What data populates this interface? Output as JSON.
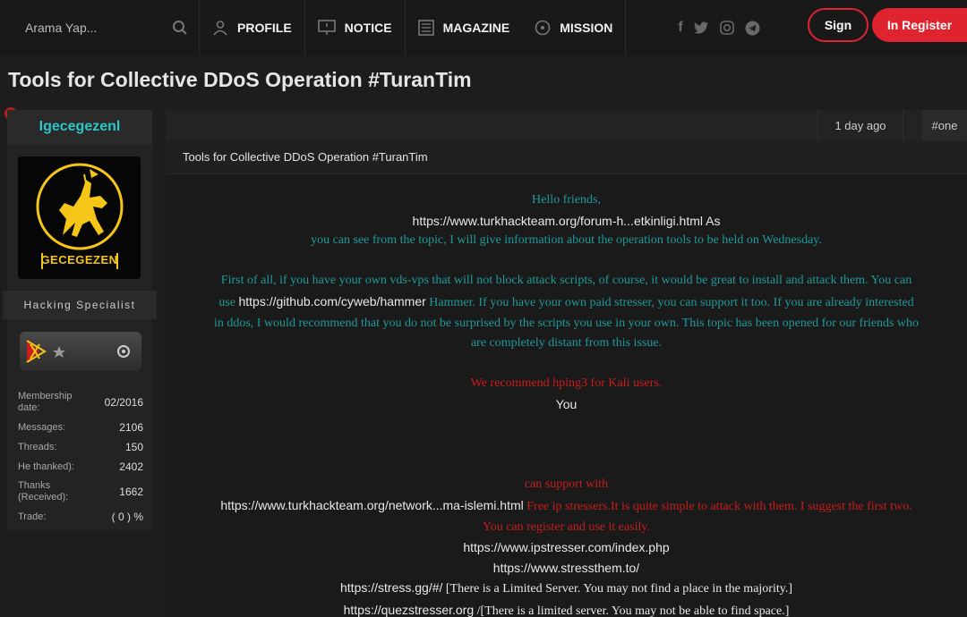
{
  "nav": {
    "search_placeholder": "Arama Yap...",
    "items": [
      "PROFILE",
      "NOTICE",
      "MAGAZINE",
      "MISSION"
    ],
    "sign_label": "Sign",
    "register_label": "In Register"
  },
  "page_title": "Tools for Collective DDoS Operation #TuranTim",
  "user": {
    "name": "Igecegezenl",
    "avatar_text": "GECEGEZEN",
    "role": "Hacking Specialist",
    "stats": [
      {
        "label": "Membership date:",
        "value": "02/2016"
      },
      {
        "label": "Messages:",
        "value": "2106"
      },
      {
        "label": "Threads:",
        "value": "150"
      },
      {
        "label": "He thanked):",
        "value": "2402"
      },
      {
        "label": "Thanks (Received):",
        "value": "1662"
      },
      {
        "label": "Trade:",
        "value": "( 0 ) %"
      }
    ]
  },
  "post": {
    "date": "1 day ago",
    "number": "#one",
    "subtitle": "Tools for Collective DDoS Operation #TuranTim",
    "greeting": "Hello friends,",
    "link1": "https://www.turkhackteam.org/forum-h...etkinligi.html",
    "link1_tail": " As",
    "line3": "you can see from the topic, I will give information about the operation tools to be held on Wednesday.",
    "p2_line1": "First of all, if you have your own vds-vps that will not block attack scripts, of course, it would be great to install and attack them. You can",
    "p2_line2_pre": "use ",
    "p2_link": "https://github.com/cyweb/hammer",
    "p2_line2_post": " Hammer. If you have your own paid stresser, you can support it too. If you are already interested",
    "p2_line3": "in ddos, I would recommend that you do not be surprised by the scripts you use in your own. This topic has been opened for our friends who",
    "p2_line4": "are completely distant from this issue.",
    "recommend": "We recommend hping3 for Kali users.",
    "you": "You",
    "support": "can support with",
    "link2": "https://www.turkhackteam.org/network...ma-islemi.html",
    "free_text": " Free ip stressers.It is quite simple to attack with them. I suggest the first two.",
    "register_text": "You can register and use it easily.",
    "link3": "https://www.ipstresser.com/index.php",
    "link4": "https://www.stressthem.to/",
    "link5": "https://stress.gg/#/",
    "link5_note": " [There is a Limited Server. You may not find a place in the majority.]",
    "link6": "https://quezstresser.org",
    "link6_note": " /[There is a limited server. You may not be able to find space.]"
  },
  "colors": {
    "accent_red": "#e0242f",
    "teal": "#1e9a9a",
    "username": "#2cc6c6"
  },
  "icons": [
    "search-icon",
    "user-icon",
    "monitor-icon",
    "newspaper-icon",
    "compass-icon",
    "facebook-icon",
    "twitter-icon",
    "instagram-icon",
    "telegram-icon"
  ]
}
